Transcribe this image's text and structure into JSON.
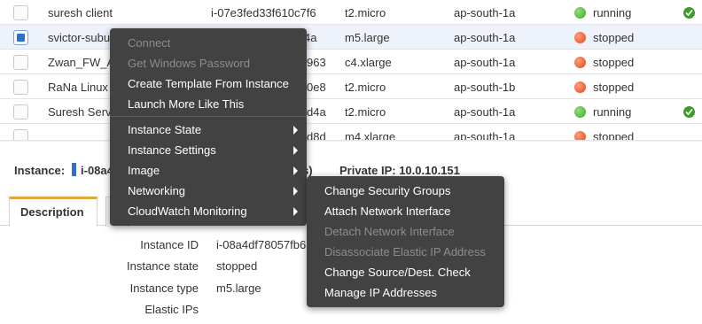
{
  "instances": [
    {
      "name": "suresh client",
      "id": "i-07e3fed33f610c7f6",
      "type": "t2.micro",
      "zone": "ap-south-1a",
      "state": "running",
      "state_color": "green",
      "check": true,
      "selected": false
    },
    {
      "name": "svictor-subu",
      "id": "4a",
      "type": "m5.large",
      "zone": "ap-south-1a",
      "state": "stopped",
      "state_color": "red",
      "check": false,
      "selected": true
    },
    {
      "name": "Zwan_FW_A",
      "id": "963",
      "type": "c4.xlarge",
      "zone": "ap-south-1a",
      "state": "stopped",
      "state_color": "red",
      "check": false,
      "selected": false
    },
    {
      "name": "RaNa Linux",
      "id": "0e8",
      "type": "t2.micro",
      "zone": "ap-south-1b",
      "state": "stopped",
      "state_color": "red",
      "check": false,
      "selected": false
    },
    {
      "name": "Suresh Serv",
      "id": "d4a",
      "type": "t2.micro",
      "zone": "ap-south-1a",
      "state": "running",
      "state_color": "green",
      "check": true,
      "selected": false
    },
    {
      "name": "",
      "id": "d8d",
      "type": "m4.xlarge",
      "zone": "ap-south-1a",
      "state": "stopped",
      "state_color": "red",
      "check": false,
      "selected": false
    }
  ],
  "detail": {
    "instance_label": "Instance:",
    "instance_id": "i-08a4",
    "paren": "s)",
    "private_ip": "Private IP: 10.0.10.151",
    "tab_description": "Description",
    "fields": [
      {
        "label": "Instance ID",
        "value": "i-08a4df78057fb6"
      },
      {
        "label": "Instance state",
        "value": "stopped"
      },
      {
        "label": "Instance type",
        "value": "m5.large"
      },
      {
        "label": "Elastic IPs",
        "value": ""
      }
    ]
  },
  "context_menu": {
    "connect": "Connect",
    "get_password": "Get Windows Password",
    "create_template": "Create Template From Instance",
    "launch_more": "Launch More Like This",
    "instance_state": "Instance State",
    "instance_settings": "Instance Settings",
    "image": "Image",
    "networking": "Networking",
    "cloudwatch": "CloudWatch Monitoring"
  },
  "networking_submenu": {
    "change_sg": "Change Security Groups",
    "attach_ni": "Attach Network Interface",
    "detach_ni": "Detach Network Interface",
    "disassociate_eip": "Disassociate Elastic IP Address",
    "change_src_dest": "Change Source/Dest. Check",
    "manage_ip": "Manage IP Addresses"
  },
  "colors": {
    "menu_bg": "#424242",
    "selected_row": "#eef3fb",
    "accent_blue": "#2d72c8",
    "tab_accent": "#e7a33e",
    "running_green": "#3fa51f",
    "stopped_red": "#e0451a"
  }
}
